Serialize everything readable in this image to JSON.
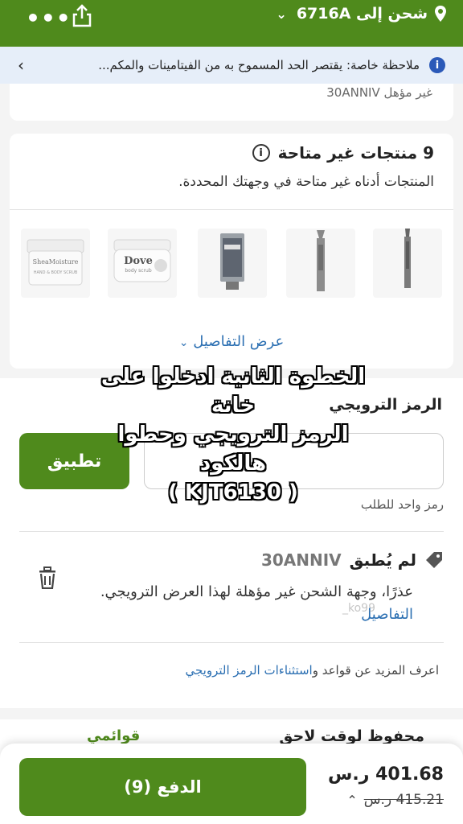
{
  "header": {
    "shipping_label": "شحن إلى 6716A",
    "more_label": "•••",
    "colors": {
      "bar": "#4f8a1c"
    }
  },
  "notice": {
    "text": "ملاحظة خاصة: يقتصر الحد المسموح به من الفيتامينات والمكم...",
    "info_icon": "i"
  },
  "top_card": {
    "ineligible_text": "غير مؤهل 30ANNIV"
  },
  "unavailable": {
    "title": "9 منتجات غير متاحة",
    "subtitle": "المنتجات أدناه غير متاحة في وجهتك المحددة.",
    "products": [
      {
        "name": "body scrub jar",
        "icon": "jar-icon"
      },
      {
        "name": "dove body scrub",
        "icon": "jar-icon"
      },
      {
        "name": "toothpaste tube",
        "icon": "tube-icon"
      },
      {
        "name": "eyebrow pencil",
        "icon": "pencil-icon"
      },
      {
        "name": "eye pencil",
        "icon": "pencil-icon"
      }
    ],
    "dove_label": "Dove",
    "dove_sub": "body scrub",
    "show_details": "عرض التفاصيل"
  },
  "promo": {
    "label": "الرمز الترويجي",
    "input_value": "",
    "apply_label": "تطبيق",
    "hint": "رمز واحد للطلب",
    "status_not_applied": "لم يُطبق",
    "code": "30ANNIV",
    "sorry_text": "عذرًا، وجهة الشحن غير مؤهلة لهذا العرض الترويجي.",
    "details_link": "التفاصيل",
    "rules_prefix": "اعرف المزيد عن قواعد و",
    "rules_link": "استثناءات الرمز الترويجي"
  },
  "saved": {
    "saved_later": "محفوظ لوقت لاحق",
    "my_lists": "قوائمي"
  },
  "footer": {
    "pay_label": "الدفع (9)",
    "total": "401.68 ر.س",
    "old_total": "415.21 ر.س"
  },
  "overlay": {
    "line1": "الخطوة الثانية ادخلوا على خانة",
    "line2": "الرمز الترويجي وحطوا هالكود",
    "line3": "( KJT6130 )"
  },
  "watermark": "_ko99"
}
